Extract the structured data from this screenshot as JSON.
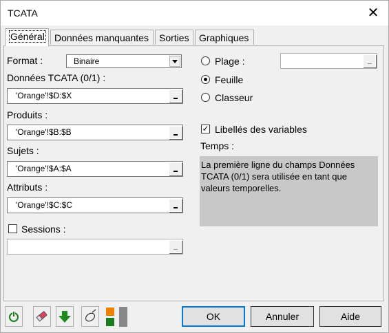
{
  "window": {
    "title": "TCATA"
  },
  "tabs": [
    {
      "label": "Général"
    },
    {
      "label": "Données manquantes"
    },
    {
      "label": "Sorties"
    },
    {
      "label": "Graphiques"
    }
  ],
  "left": {
    "format_label": "Format :",
    "format_value": "Binaire",
    "data_label": "Données TCATA (0/1) :",
    "data_value": "'Orange'!$D:$X",
    "products_label": "Produits :",
    "products_value": "'Orange'!$B:$B",
    "subjects_label": "Sujets :",
    "subjects_value": "'Orange'!$A:$A",
    "attributes_label": "Attributs :",
    "attributes_value": "'Orange'!$C:$C",
    "sessions_label": "Sessions :",
    "sessions_value": ""
  },
  "right": {
    "range_label": "Plage :",
    "sheet_label": "Feuille",
    "workbook_label": "Classeur",
    "varlabels_label": "Libellés des variables",
    "time_label": "Temps :",
    "time_text": "La première ligne du champs Données TCATA (0/1) sera utilisée en tant que valeurs temporelles."
  },
  "buttons": {
    "ok": "OK",
    "cancel": "Annuler",
    "help": "Aide"
  },
  "colors": {
    "accent": "#0078d7",
    "green": "#1e7a1e",
    "orange": "#f08000"
  }
}
